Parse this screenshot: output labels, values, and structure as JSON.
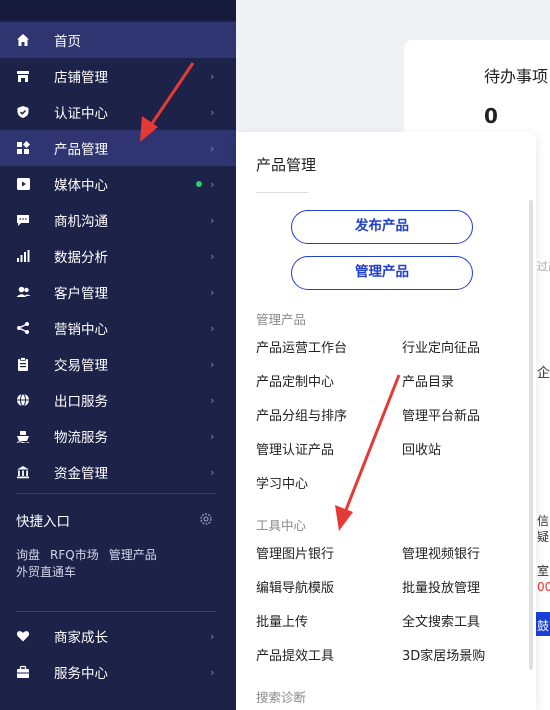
{
  "sidebar": {
    "items": [
      {
        "label": "首页",
        "icon": "home-icon"
      },
      {
        "label": "店铺管理",
        "icon": "store-icon"
      },
      {
        "label": "认证中心",
        "icon": "shield-icon"
      },
      {
        "label": "产品管理",
        "icon": "grid-icon"
      },
      {
        "label": "媒体中心",
        "icon": "media-icon"
      },
      {
        "label": "商机沟通",
        "icon": "chat-icon"
      },
      {
        "label": "数据分析",
        "icon": "bar-chart-icon"
      },
      {
        "label": "客户管理",
        "icon": "users-icon"
      },
      {
        "label": "营销中心",
        "icon": "share-icon"
      },
      {
        "label": "交易管理",
        "icon": "clipboard-icon"
      },
      {
        "label": "出口服务",
        "icon": "globe-icon"
      },
      {
        "label": "物流服务",
        "icon": "ship-icon"
      },
      {
        "label": "资金管理",
        "icon": "bank-icon"
      }
    ],
    "arrow": "›",
    "quick_entry": {
      "title": "快捷入口",
      "links": [
        "询盘",
        "RFQ市场",
        "管理产品",
        "外贸直通车"
      ]
    },
    "bottom_items": [
      {
        "label": "商家成长",
        "icon": "heart-icon"
      },
      {
        "label": "服务中心",
        "icon": "briefcase-icon"
      }
    ]
  },
  "background": {
    "todo_title": "待办事项",
    "todo_count": "0",
    "fragments": [
      "过产",
      "企业",
      "信",
      "疑",
      "室",
      "00",
      "鼓"
    ]
  },
  "popup": {
    "title": "产品管理",
    "primary_buttons": [
      "发布产品",
      "管理产品"
    ],
    "sections": [
      {
        "title": "管理产品",
        "links": [
          "产品运营工作台",
          "行业定向征品",
          "产品定制中心",
          "产品目录",
          "产品分组与排序",
          "管理平台新品",
          "管理认证产品",
          "回收站",
          "学习中心"
        ]
      },
      {
        "title": "工具中心",
        "links": [
          "管理图片银行",
          "管理视频银行",
          "编辑导航模版",
          "批量投放管理",
          "批量上传",
          "全文搜索工具",
          "产品提效工具",
          "3D家居场景购"
        ]
      },
      {
        "title": "搜索诊断",
        "links": []
      }
    ]
  },
  "colors": {
    "sidebar_bg": "#1d2249",
    "active_bg": "#2f3570",
    "accent_blue": "#1f3fd0",
    "annotation_red": "#e53935"
  }
}
